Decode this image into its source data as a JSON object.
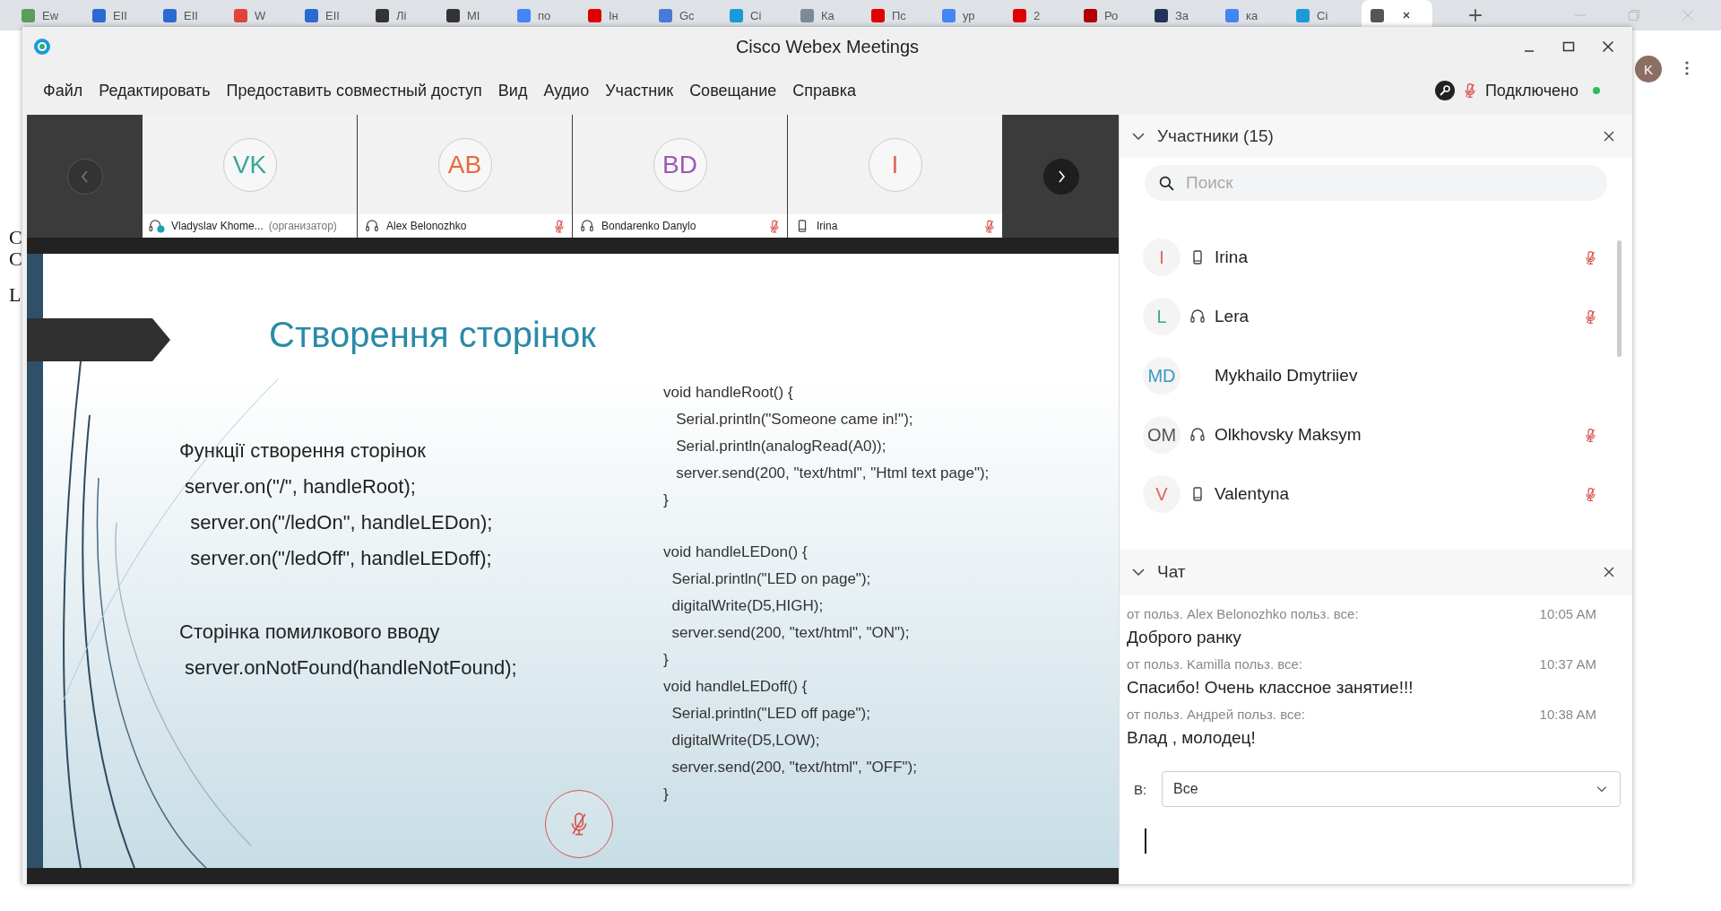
{
  "browser": {
    "tabs": [
      {
        "label": "Ew",
        "color": "#5a9e5a",
        "selected": false
      },
      {
        "label": "EII",
        "color": "#2a6bd1",
        "selected": false
      },
      {
        "label": "EII",
        "color": "#2a6bd1",
        "selected": false
      },
      {
        "label": "W",
        "color": "#e0443a",
        "selected": false
      },
      {
        "label": "EII",
        "color": "#2a6bd1",
        "selected": false
      },
      {
        "label": "Лі",
        "color": "#333333",
        "selected": false
      },
      {
        "label": "МІ",
        "color": "#333333",
        "selected": false
      },
      {
        "label": "по",
        "color": "#4285f4",
        "selected": false
      },
      {
        "label": "Ін",
        "color": "#e00000",
        "selected": false
      },
      {
        "label": "Gc",
        "color": "#4a7ad8",
        "selected": false
      },
      {
        "label": "Ci",
        "color": "#1a9bd7",
        "selected": false
      },
      {
        "label": "Ка",
        "color": "#7a8a9a",
        "selected": false
      },
      {
        "label": "Пс",
        "color": "#e00000",
        "selected": false
      },
      {
        "label": "ур",
        "color": "#4285f4",
        "selected": false
      },
      {
        "label": "2",
        "color": "#e00000",
        "selected": false
      },
      {
        "label": "Ро",
        "color": "#b00000",
        "selected": false
      },
      {
        "label": "За",
        "color": "#223355",
        "selected": false
      },
      {
        "label": "ка",
        "color": "#4285f4",
        "selected": false
      },
      {
        "label": "Ci",
        "color": "#1a9bd7",
        "selected": false
      },
      {
        "color": "#555555",
        "selected": true
      }
    ],
    "avatar": "K"
  },
  "background_page": {
    "fragments": [
      "C",
      "C",
      "L"
    ]
  },
  "window": {
    "title": "Cisco Webex Meetings"
  },
  "menu": [
    "Файл",
    "Редактировать",
    "Предоставить совместный доступ",
    "Вид",
    "Аудио",
    "Участник",
    "Совещание",
    "Справка"
  ],
  "connection": {
    "label": "Подключено",
    "connected": true,
    "muted": true
  },
  "video_strip": {
    "tiles": [
      {
        "initials": "VK",
        "color": "#3aa59b",
        "name": "Vladyslav Khome...",
        "role": "(организатор)",
        "kind": "host",
        "muted": false
      },
      {
        "initials": "AB",
        "color": "#e56a3a",
        "name": "Alex Belonozhko",
        "kind": "headset",
        "muted": true
      },
      {
        "initials": "BD",
        "color": "#9b59b6",
        "name": "Bondarenko Danylo",
        "kind": "headset",
        "muted": true
      },
      {
        "initials": "I",
        "color": "#e0645a",
        "name": "Irina",
        "kind": "phone",
        "muted": true
      }
    ]
  },
  "slide": {
    "title": "Створення сторінок",
    "left_groups": [
      [
        "Функції створення сторінок",
        " server.on(\"/\", handleRoot);",
        "  server.on(\"/ledOn\", handleLEDon);",
        "  server.on(\"/ledOff\", handleLEDoff);"
      ],
      [
        "Сторінка помилкового вводу",
        " server.onNotFound(handleNotFound);"
      ]
    ],
    "code_blocks": [
      {
        "spaced": true,
        "lines": [
          "void handleRoot() {",
          "   Serial.println(\"Someone came in!\");",
          "   Serial.println(analogRead(A0));",
          "   server.send(200, \"text/html\", \"Html text page\");",
          "}"
        ]
      },
      {
        "spaced": false,
        "lines": [
          "void handleLEDon() {",
          "  Serial.println(\"LED on page\");",
          "  digitalWrite(D5,HIGH);",
          "  server.send(200, \"text/html\", \"ON\");",
          "}"
        ]
      },
      {
        "spaced": false,
        "lines": [
          "void handleLEDoff() {",
          "  Serial.println(\"LED off page\");",
          "  digitalWrite(D5,LOW);",
          "  server.send(200, \"text/html\", \"OFF\");",
          "}"
        ]
      }
    ]
  },
  "participants": {
    "title": "Участники (15)",
    "search_placeholder": "Поиск",
    "items": [
      {
        "initials": "I",
        "color": "#e0645a",
        "kind": "phone",
        "name": "Irina",
        "muted": true
      },
      {
        "initials": "L",
        "color": "#3aa59b",
        "kind": "headset",
        "name": "Lera",
        "muted": true
      },
      {
        "initials": "MD",
        "color": "#3a9ac9",
        "kind": "none",
        "name": "Mykhailo Dmytriiev",
        "muted": false
      },
      {
        "initials": "OM",
        "color": "#555555",
        "kind": "headset",
        "name": "Olkhovsky Maksym",
        "muted": true
      },
      {
        "initials": "V",
        "color": "#e0645a",
        "kind": "phone",
        "name": "Valentyna",
        "muted": true
      }
    ]
  },
  "chat": {
    "title": "Чат",
    "messages": [
      {
        "meta": "от польз. Alex Belonozhko польз. все:",
        "time": "10:05 AM",
        "text": "Доброго ранку"
      },
      {
        "meta": "от польз. Kamilla польз. все:",
        "time": "10:37 AM",
        "text": "Спасибо! Очень классное занятие!!!"
      },
      {
        "meta": "от польз. Андрей польз. все:",
        "time": "10:38 AM",
        "text": "Влад , молодец!"
      }
    ],
    "to_label": "В:",
    "to_value": "Все"
  }
}
